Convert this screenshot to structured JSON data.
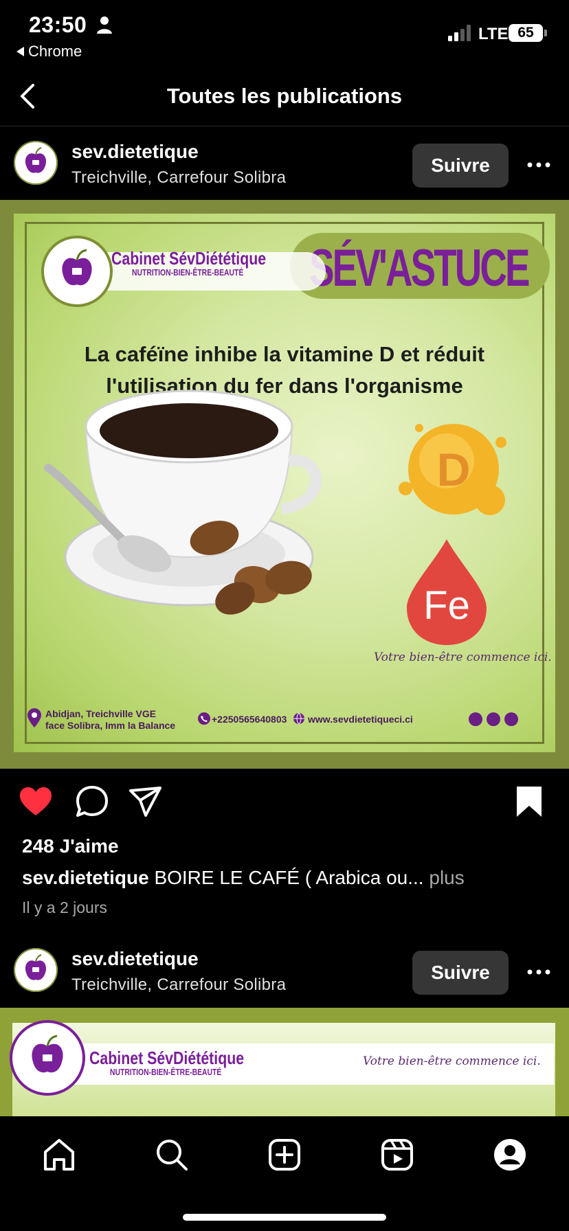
{
  "status_bar": {
    "time": "23:50",
    "back_app": "Chrome",
    "network": "LTE",
    "battery": "65"
  },
  "nav": {
    "title": "Toutes les publications"
  },
  "posts": [
    {
      "username": "sev.dietetique",
      "location": "Treichville, Carrefour Solibra",
      "follow_label": "Suivre",
      "image": {
        "brand_name": "Cabinet SévDiététique",
        "brand_tagline": "NUTRITION-BIEN-ÊTRE-BEAUTÉ",
        "tag": "SÉV'ASTUCE",
        "headline_line1": "La caféïne inhibe la vitamine D et réduit",
        "headline_line2": "l'utilisation du fer dans l'organisme",
        "vitamin_label": "D",
        "iron_label": "Fe",
        "slogan": "Votre bien-être commence ici.",
        "address_line1": "Abidjan, Treichville VGE",
        "address_line2": "face Solibra, Imm la Balance",
        "phone": "+2250565640803",
        "website": "www.sevdietetiqueci.ci"
      },
      "liked": true,
      "likes_text": "248 J'aime",
      "caption_user": "sev.dietetique",
      "caption_text": "BOIRE LE CAFÉ ( Arabica ou...",
      "caption_more": "plus",
      "time_ago": "Il y a 2 jours"
    },
    {
      "username": "sev.dietetique",
      "location": "Treichville, Carrefour Solibra",
      "follow_label": "Suivre",
      "image": {
        "brand_name": "Cabinet SévDiététique",
        "brand_tagline": "NUTRITION-BIEN-ÊTRE-BEAUTÉ",
        "slogan": "Votre bien-être commence ici."
      }
    }
  ],
  "colors": {
    "accent_purple": "#7a1f9a",
    "like_red": "#ff3040",
    "frame_olive": "#7e8b3c"
  },
  "tabs": [
    "home-icon",
    "search-icon",
    "create-icon",
    "reels-icon",
    "profile-icon"
  ]
}
